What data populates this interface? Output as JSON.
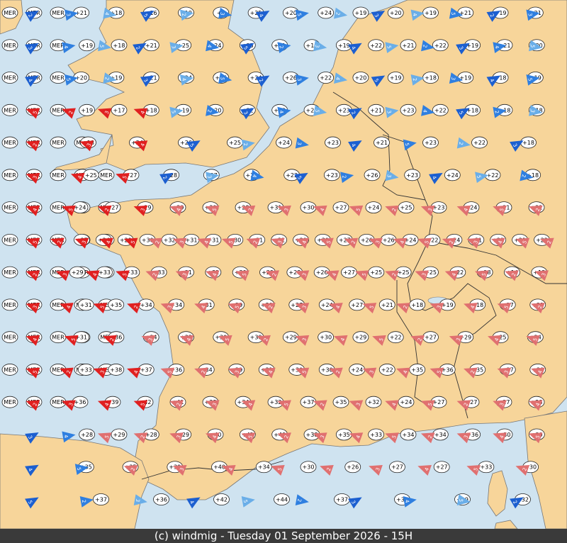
{
  "map": {
    "footer": "(c) windmig - Tuesday 01 September 2026 - 15H",
    "colors": {
      "sea": "#cfe3f0",
      "land": "#f7d59a",
      "border": "#333333",
      "footer_bg": "#3a3a3a",
      "footer_text": "#ffffff",
      "wind_light_blue": "#6aaee8",
      "wind_blue": "#2f7fe0",
      "wind_deep_blue": "#1c5fd0",
      "wind_pink": "#e07070",
      "wind_red": "#e02020"
    },
    "sea_label": "MER",
    "temperature_rows": [
      [
        "+21",
        "+18",
        "+16",
        "+19",
        "+2",
        "+25",
        "+20",
        "+24",
        "+19",
        "+20",
        "+19",
        "+21",
        "+19",
        "+21"
      ],
      [
        "+19",
        "+18",
        "+21",
        "+25",
        "+24",
        "+25",
        "+21",
        "+19",
        "+19",
        "+22",
        "+21",
        "+22",
        "+19",
        "+21",
        "+20"
      ],
      [
        "+20",
        "+19",
        "+21",
        "+24",
        "+25",
        "+24",
        "+26",
        "+22",
        "+20",
        "+19",
        "+18",
        "+19",
        "+18",
        "+19"
      ],
      [
        "+19",
        "+17",
        "+18",
        "+19",
        "+20",
        "+22",
        "+23",
        "+22",
        "+23",
        "+21",
        "+23",
        "+22",
        "+18",
        "+18",
        "+18"
      ],
      [
        "+18",
        "+24",
        "+26",
        "+25",
        "+24",
        "+23",
        "+21",
        "+23",
        "+22",
        "+18"
      ],
      [
        "+25",
        "+27",
        "+28",
        "+27",
        "+24",
        "+22",
        "+23",
        "+26",
        "+23",
        "+24",
        "+22",
        "+18"
      ],
      [
        "+24",
        "+27",
        "+29",
        "+29",
        "+30",
        "+28",
        "+31",
        "+30",
        "+27",
        "+24",
        "+25",
        "+23",
        "+24",
        "+21",
        "+21"
      ],
      [
        "+27",
        "+24",
        "+20",
        "+30",
        "+32",
        "+31",
        "+31",
        "+30",
        "+31",
        "+31",
        "+29",
        "+30",
        "+27",
        "+26",
        "+26",
        "+24",
        "+22",
        "+24",
        "+21",
        "+22",
        "+21",
        "+22"
      ],
      [
        "+29",
        "+33",
        "+33",
        "+33",
        "+31",
        "+31",
        "+30",
        "+29",
        "+28",
        "+26",
        "+27",
        "+25",
        "+25",
        "+25",
        "+22",
        "+18",
        "+14",
        "+13"
      ],
      [
        "+31",
        "+35",
        "+34",
        "+34",
        "+31",
        "+29",
        "+30",
        "+27",
        "+24",
        "+27",
        "+21",
        "+18",
        "+19",
        "+18",
        "+17",
        "+21"
      ],
      [
        "+31",
        "+36",
        "+34",
        "+33",
        "+30",
        "+30",
        "+29",
        "+30",
        "+29",
        "+22",
        "+27",
        "+29",
        "+25",
        "+24"
      ],
      [
        "+33",
        "+38",
        "+37",
        "+36",
        "+34",
        "+29",
        "+31",
        "+30",
        "+30",
        "+24",
        "+22",
        "+35",
        "+36",
        "+35",
        "+37",
        "+38"
      ],
      [
        "+36",
        "+39",
        "+42",
        "+41",
        "+38",
        "+34",
        "+32",
        "+37",
        "+35",
        "+32",
        "+24",
        "+27",
        "+27",
        "+27",
        "+28"
      ],
      [
        "+28",
        "+29",
        "+28",
        "+29",
        "+40",
        "+42",
        "+40",
        "+38",
        "+35",
        "+33",
        "+34",
        "+34",
        "+36",
        "+30",
        "+29"
      ],
      [
        "+35",
        "+35",
        "+39",
        "+40",
        "+34",
        "+30",
        "+26",
        "+27",
        "+27",
        "+33",
        "+30"
      ],
      [
        "+37",
        "+36",
        "+42",
        "+44",
        "+37",
        "+32",
        "+29",
        "+32"
      ]
    ],
    "wind_speeds": [
      "2",
      "3",
      "4",
      "5"
    ]
  }
}
